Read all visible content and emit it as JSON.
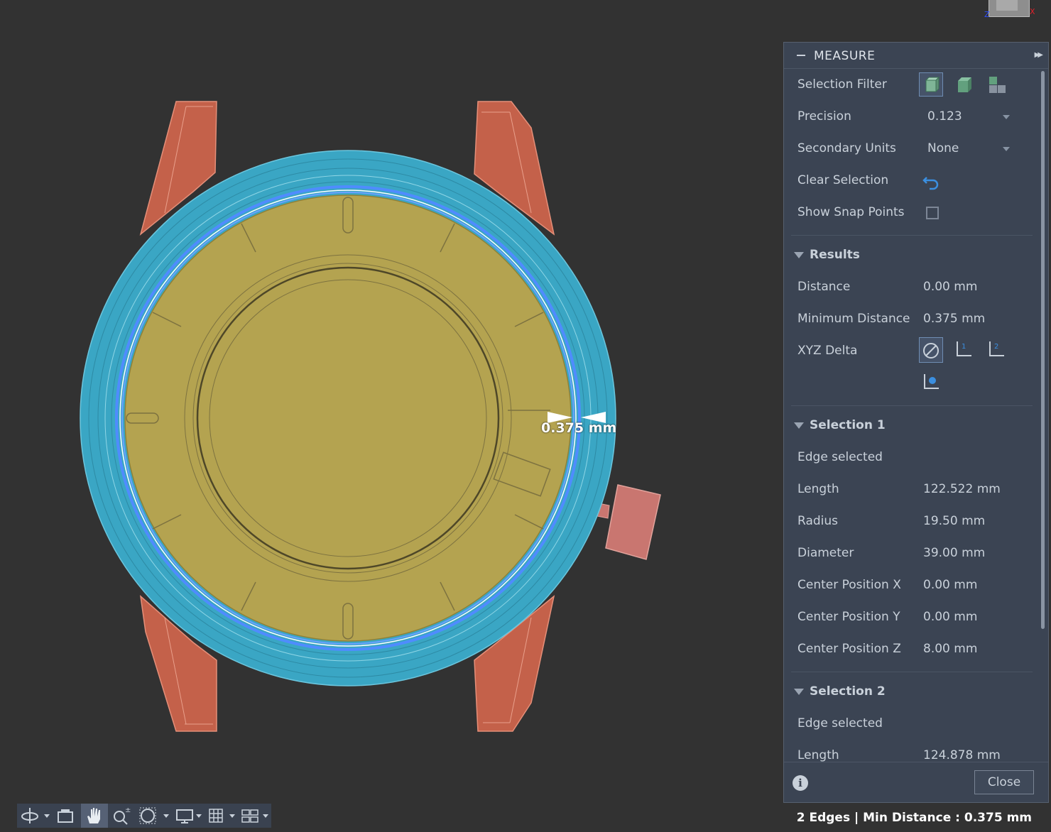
{
  "viewcube": {
    "axis_z": "Z",
    "axis_x": "X"
  },
  "viewport": {
    "measure_label": "0.375 mm"
  },
  "panel": {
    "title": "MEASURE",
    "selection_filter_label": "Selection Filter",
    "precision_label": "Precision",
    "precision_value": "0.123",
    "secondary_units_label": "Secondary Units",
    "secondary_units_value": "None",
    "clear_selection_label": "Clear Selection",
    "show_snap_points_label": "Show Snap Points",
    "results": {
      "header": "Results",
      "distance_label": "Distance",
      "distance_value": "0.00 mm",
      "min_distance_label": "Minimum Distance",
      "min_distance_value": "0.375 mm",
      "xyz_delta_label": "XYZ Delta"
    },
    "selection1": {
      "header": "Selection 1",
      "type": "Edge selected",
      "length_label": "Length",
      "length_value": "122.522 mm",
      "radius_label": "Radius",
      "radius_value": "19.50 mm",
      "diameter_label": "Diameter",
      "diameter_value": "39.00 mm",
      "cx_label": "Center Position X",
      "cx_value": "0.00 mm",
      "cy_label": "Center Position Y",
      "cy_value": "0.00 mm",
      "cz_label": "Center Position Z",
      "cz_value": "8.00 mm"
    },
    "selection2": {
      "header": "Selection 2",
      "type": "Edge selected",
      "length_label": "Length",
      "length_value": "124.878 mm"
    },
    "close_label": "Close",
    "info_glyph": "i"
  },
  "status_bar": {
    "text": "2 Edges | Min Distance : 0.375 mm"
  },
  "toolbar": {
    "icons": [
      "orbit-icon",
      "look-at-icon",
      "pan-icon",
      "zoom-icon",
      "fit-window-icon",
      "display-settings-icon",
      "grid-icon",
      "viewports-icon"
    ]
  },
  "colors": {
    "background": "#323232",
    "panel": "#3b4453",
    "lug": "#c4614a",
    "bezel": "#3aa6c4",
    "dial": "#b4a350",
    "highlight": "#4f8cff",
    "crown": "#c97670"
  }
}
